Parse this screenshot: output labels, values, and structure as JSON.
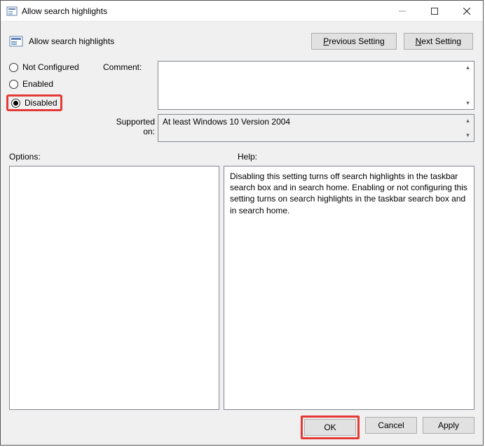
{
  "window": {
    "title": "Allow search highlights"
  },
  "header": {
    "policy_title": "Allow search highlights",
    "previous": "Previous Setting",
    "next": "Next Setting",
    "previous_u": "P",
    "next_u": "N"
  },
  "state": {
    "labels": {
      "not_configured": "Not Configured",
      "enabled": "Enabled",
      "disabled": "Disabled"
    },
    "selected": "disabled"
  },
  "fields": {
    "comment_label": "Comment:",
    "comment_value": "",
    "supported_label": "Supported on:",
    "supported_value": "At least Windows 10 Version 2004"
  },
  "sections": {
    "options_label": "Options:",
    "help_label": "Help:",
    "help_text": "Disabling this setting turns off search highlights in the taskbar search box and in search home. Enabling or not configuring this setting turns on search highlights in the taskbar search box and in search home."
  },
  "footer": {
    "ok": "OK",
    "cancel": "Cancel",
    "apply": "Apply"
  }
}
